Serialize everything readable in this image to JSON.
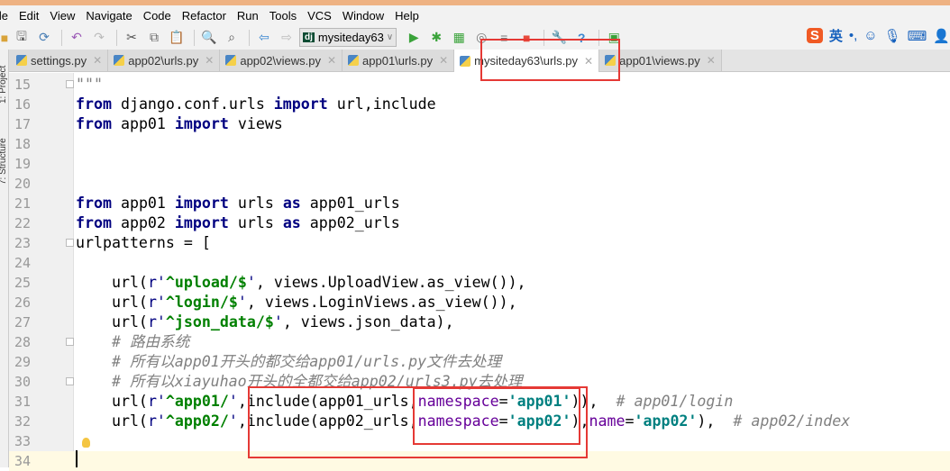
{
  "menu": [
    "ile",
    "Edit",
    "View",
    "Navigate",
    "Code",
    "Refactor",
    "Run",
    "Tools",
    "VCS",
    "Window",
    "Help"
  ],
  "run_config": "mysiteday63",
  "ime": {
    "logo": "S",
    "lang": "英"
  },
  "side_tabs": [
    "1: Project",
    "7: Structure"
  ],
  "tabs": [
    {
      "label": "settings.py",
      "active": false
    },
    {
      "label": "app02\\urls.py",
      "active": false
    },
    {
      "label": "app02\\views.py",
      "active": false
    },
    {
      "label": "app01\\urls.py",
      "active": false
    },
    {
      "label": "mysiteday63\\urls.py",
      "active": true
    },
    {
      "label": "app01\\views.py",
      "active": false
    }
  ],
  "code_lines": [
    {
      "n": "15",
      "t": [
        [
          "\"\"\"",
          "cm"
        ]
      ]
    },
    {
      "n": "16",
      "t": [
        [
          "from",
          "kw"
        ],
        [
          " django.conf.urls ",
          ""
        ],
        [
          "import",
          "kw"
        ],
        [
          " url,include",
          ""
        ]
      ]
    },
    {
      "n": "17",
      "t": [
        [
          "from",
          "kw"
        ],
        [
          " app01 ",
          ""
        ],
        [
          "import",
          "kw"
        ],
        [
          " views",
          ""
        ]
      ]
    },
    {
      "n": "18",
      "t": []
    },
    {
      "n": "19",
      "t": []
    },
    {
      "n": "20",
      "t": []
    },
    {
      "n": "21",
      "t": [
        [
          "from",
          "kw"
        ],
        [
          " app01 ",
          ""
        ],
        [
          "import",
          "kw"
        ],
        [
          " urls ",
          ""
        ],
        [
          "as",
          "kw"
        ],
        [
          " app01_urls",
          ""
        ]
      ]
    },
    {
      "n": "22",
      "t": [
        [
          "from",
          "kw"
        ],
        [
          " app02 ",
          ""
        ],
        [
          "import",
          "kw"
        ],
        [
          " urls ",
          ""
        ],
        [
          "as",
          "kw"
        ],
        [
          " app02_urls",
          ""
        ]
      ]
    },
    {
      "n": "23",
      "t": [
        [
          "urlpatterns = [",
          ""
        ]
      ]
    },
    {
      "n": "24",
      "t": []
    },
    {
      "n": "25",
      "t": [
        [
          "    url(",
          ""
        ],
        [
          "r'",
          "sp"
        ],
        [
          "^upload/$",
          "rx"
        ],
        [
          "'",
          "sp"
        ],
        [
          ", views.UploadView.as_view()),",
          ""
        ]
      ]
    },
    {
      "n": "26",
      "t": [
        [
          "    url(",
          ""
        ],
        [
          "r'",
          "sp"
        ],
        [
          "^login/$",
          "rx"
        ],
        [
          "'",
          "sp"
        ],
        [
          ", views.LoginViews.as_view()),",
          ""
        ]
      ]
    },
    {
      "n": "27",
      "t": [
        [
          "    url(",
          ""
        ],
        [
          "r'",
          "sp"
        ],
        [
          "^json_data/$",
          "rx"
        ],
        [
          "'",
          "sp"
        ],
        [
          ", views.json_data),",
          ""
        ]
      ]
    },
    {
      "n": "28",
      "t": [
        [
          "    # 路由系统",
          "cm"
        ]
      ]
    },
    {
      "n": "29",
      "t": [
        [
          "    # 所有以app01开头的都交给app01/urls.py文件去处理",
          "cm"
        ]
      ]
    },
    {
      "n": "30",
      "t": [
        [
          "    # 所有以xiayuhao开头的全都交给app02/urls3.py去处理",
          "cm"
        ]
      ]
    },
    {
      "n": "31",
      "t": [
        [
          "    url(",
          ""
        ],
        [
          "r'",
          "sp"
        ],
        [
          "^app01/",
          "rx"
        ],
        [
          "'",
          "sp"
        ],
        [
          ",include(app01_urls,",
          ""
        ],
        [
          "namespace",
          "kwarg"
        ],
        [
          "=",
          ""
        ],
        [
          "'app01'",
          "str"
        ],
        [
          ")),  ",
          ""
        ],
        [
          "# app01/login",
          "cm"
        ]
      ]
    },
    {
      "n": "32",
      "t": [
        [
          "    url(",
          ""
        ],
        [
          "r'",
          "sp"
        ],
        [
          "^app02/",
          "rx"
        ],
        [
          "'",
          "sp"
        ],
        [
          ",include(app02_urls,",
          ""
        ],
        [
          "namespace",
          "kwarg"
        ],
        [
          "=",
          ""
        ],
        [
          "'app02'",
          "str"
        ],
        [
          "),",
          ""
        ],
        [
          "name",
          "kwarg"
        ],
        [
          "=",
          ""
        ],
        [
          "'app02'",
          "str"
        ],
        [
          "),  ",
          ""
        ],
        [
          "# app02/index",
          "cm"
        ]
      ]
    },
    {
      "n": "33",
      "t": []
    },
    {
      "n": "34",
      "t": []
    }
  ]
}
